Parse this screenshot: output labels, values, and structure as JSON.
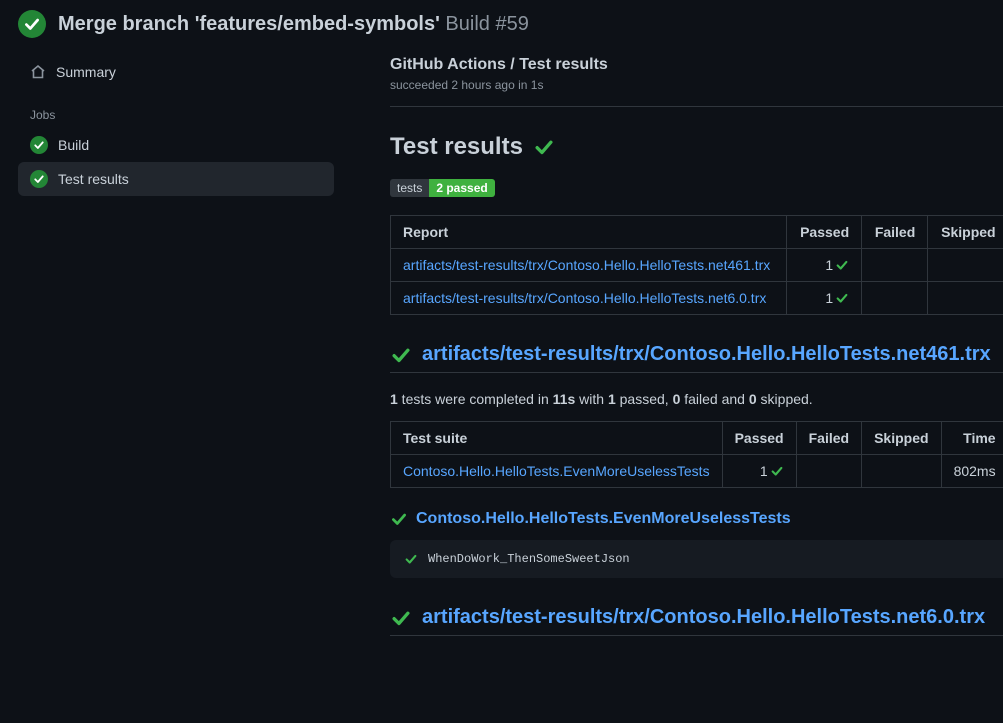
{
  "header": {
    "title": "Merge branch 'features/embed-symbols'",
    "build_label": "Build #59"
  },
  "sidebar": {
    "summary_label": "Summary",
    "jobs_heading": "Jobs",
    "jobs": [
      {
        "label": "Build"
      },
      {
        "label": "Test results"
      }
    ],
    "active_index": 1
  },
  "breadcrumb": {
    "owner": "GitHub Actions",
    "sep": " / ",
    "page": "Test results",
    "status_line": "succeeded 2 hours ago in 1s"
  },
  "section_title": "Test results",
  "badge": {
    "left": "tests",
    "right": "2 passed"
  },
  "reports_table": {
    "columns": [
      "Report",
      "Passed",
      "Failed",
      "Skipped"
    ],
    "rows": [
      {
        "report": "artifacts/test-results/trx/Contoso.Hello.HelloTests.net461.trx",
        "passed": "1",
        "failed": "",
        "skipped": ""
      },
      {
        "report": "artifacts/test-results/trx/Contoso.Hello.HelloTests.net6.0.trx",
        "passed": "1",
        "failed": "",
        "skipped": ""
      }
    ]
  },
  "file_section_1": {
    "title": "artifacts/test-results/trx/Contoso.Hello.HelloTests.net461.trx",
    "summary_parts": {
      "p1": "1",
      "t1": " tests were completed in ",
      "p2": "11s",
      "t2": " with ",
      "p3": "1",
      "t3": " passed, ",
      "p4": "0",
      "t4": " failed and ",
      "p5": "0",
      "t5": " skipped."
    },
    "table": {
      "columns": [
        "Test suite",
        "Passed",
        "Failed",
        "Skipped",
        "Time"
      ],
      "rows": [
        {
          "suite": "Contoso.Hello.HelloTests.EvenMoreUselessTests",
          "passed": "1",
          "failed": "",
          "skipped": "",
          "time": "802ms"
        }
      ]
    },
    "suite_heading": "Contoso.Hello.HelloTests.EvenMoreUselessTests",
    "test_item": "WhenDoWork_ThenSomeSweetJson"
  },
  "file_section_2": {
    "title": "artifacts/test-results/trx/Contoso.Hello.HelloTests.net6.0.trx"
  }
}
